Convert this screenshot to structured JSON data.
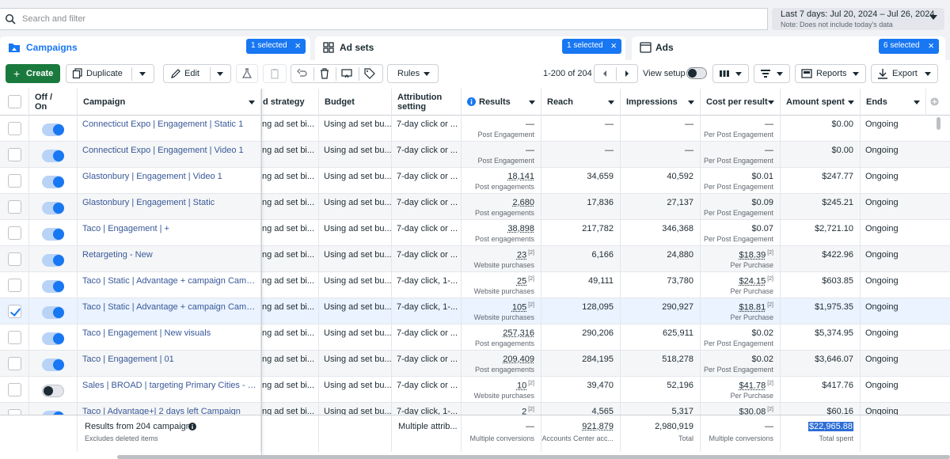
{
  "search": {
    "placeholder": "Search and filter"
  },
  "date_range": {
    "label": "Last 7 days: Jul 20, 2024 – Jul 26, 2024",
    "note": "Note: Does not include today's data"
  },
  "tabs": [
    {
      "label": "Campaigns",
      "pill": "1 selected"
    },
    {
      "label": "Ad sets",
      "pill": "1 selected"
    },
    {
      "label": "Ads",
      "pill": "6 selected"
    }
  ],
  "toolbar": {
    "create": "Create",
    "duplicate": "Duplicate",
    "edit": "Edit",
    "rules": "Rules",
    "pager": "1-200 of 204",
    "view_setup": "View setup",
    "reports": "Reports",
    "export": "Export"
  },
  "columns": {
    "onoff": "Off / On",
    "campaign": "Campaign",
    "bid_strategy": "d strategy",
    "budget": "Budget",
    "attribution": "Attribution setting",
    "results": "Results",
    "reach": "Reach",
    "impressions": "Impressions",
    "cpr": "Cost per result",
    "spent": "Amount spent",
    "ends": "Ends"
  },
  "rows": [
    {
      "name": "Connecticut Expo | Engagement | Static 1",
      "bid": "ng ad set bi...",
      "budget": "Using ad set bu...",
      "attr": "7-day click or ...",
      "results": "—",
      "results_sub": "Post Engagement",
      "reach": "—",
      "impr": "—",
      "cpr": "—",
      "cpr_sub": "Per Post Engagement",
      "spent": "$0.00",
      "ends": "Ongoing"
    },
    {
      "name": "Connecticut Expo | Engagement | Video 1",
      "bid": "ng ad set bi...",
      "budget": "Using ad set bu...",
      "attr": "7-day click or ...",
      "results": "—",
      "results_sub": "Post Engagement",
      "reach": "—",
      "impr": "—",
      "cpr": "—",
      "cpr_sub": "Per Post Engagement",
      "spent": "$0.00",
      "ends": "Ongoing"
    },
    {
      "name": "Glastonbury | Engagement | Video 1",
      "bid": "ng ad set bi...",
      "budget": "Using ad set bu...",
      "attr": "7-day click or ...",
      "results": "18,141",
      "results_sub": "Post engagements",
      "reach": "34,659",
      "impr": "40,592",
      "cpr": "$0.01",
      "cpr_sub": "Per Post Engagement",
      "spent": "$247.77",
      "ends": "Ongoing"
    },
    {
      "name": "Glastonbury | Engagement | Static",
      "bid": "ng ad set bi...",
      "budget": "Using ad set bu...",
      "attr": "7-day click or ...",
      "results": "2,680",
      "results_sub": "Post engagements",
      "reach": "17,836",
      "impr": "27,137",
      "cpr": "$0.09",
      "cpr_sub": "Per Post Engagement",
      "spent": "$245.21",
      "ends": "Ongoing"
    },
    {
      "name": "Taco | Engagement | +",
      "bid": "ng ad set bi...",
      "budget": "Using ad set bu...",
      "attr": "7-day click or ...",
      "results": "38,898",
      "results_sub": "Post engagements",
      "reach": "217,782",
      "impr": "346,368",
      "cpr": "$0.07",
      "cpr_sub": "Per Post Engagement",
      "spent": "$2,721.10",
      "ends": "Ongoing"
    },
    {
      "name": "Retargeting - New",
      "bid": "ng ad set bi...",
      "budget": "Using ad set bu...",
      "attr": "7-day click or ...",
      "results": "23",
      "results_sup": "[2]",
      "results_sub": "Website purchases",
      "reach": "6,166",
      "impr": "24,880",
      "cpr": "$18.39",
      "cpr_sup": "[2]",
      "cpr_sub": "Per Purchase",
      "spent": "$422.96",
      "ends": "Ongoing"
    },
    {
      "name": "Taco | Static | Advantage + campaign Campaign - Copy",
      "bid": "ng ad set bi...",
      "budget": "Using ad set bu...",
      "attr": "7-day click, 1-...",
      "results": "25",
      "results_sup": "[2]",
      "results_sub": "Website purchases",
      "reach": "49,111",
      "impr": "73,780",
      "cpr": "$24.15",
      "cpr_sup": "[2]",
      "cpr_sub": "Per Purchase",
      "spent": "$603.85",
      "ends": "Ongoing"
    },
    {
      "name": "Taco | Static | Advantage + campaign Campaign",
      "bid": "ng ad set bi...",
      "budget": "Using ad set bu...",
      "attr": "7-day click, 1-...",
      "results": "105",
      "results_sup": "[2]",
      "results_sub": "Website purchases",
      "reach": "128,095",
      "impr": "290,927",
      "cpr": "$18.81",
      "cpr_sup": "[2]",
      "cpr_sub": "Per Purchase",
      "spent": "$1,975.35",
      "ends": "Ongoing"
    },
    {
      "name": "Taco | Engagement | New visuals",
      "bid": "ng ad set bi...",
      "budget": "Using ad set bu...",
      "attr": "7-day click or ...",
      "results": "257,316",
      "results_sub": "Post engagements",
      "reach": "290,206",
      "impr": "625,911",
      "cpr": "$0.02",
      "cpr_sub": "Per Post Engagement",
      "spent": "$5,374.95",
      "ends": "Ongoing"
    },
    {
      "name": "Taco | Engagement | 01",
      "bid": "ng ad set bi...",
      "budget": "Using ad set bu...",
      "attr": "7-day click or ...",
      "results": "209,409",
      "results_sub": "Post engagements",
      "reach": "284,195",
      "impr": "518,278",
      "cpr": "$0.02",
      "cpr_sub": "Per Post Engagement",
      "spent": "$3,646.07",
      "ends": "Ongoing"
    },
    {
      "name": "Sales | BROAD | targeting Primary Cities - Copy",
      "bid": "ng ad set bi...",
      "budget": "Using ad set bu...",
      "attr": "7-day click or ...",
      "results": "10",
      "results_sup": "[2]",
      "results_sub": "Website purchases",
      "reach": "39,470",
      "impr": "52,196",
      "cpr": "$41.78",
      "cpr_sup": "[2]",
      "cpr_sub": "Per Purchase",
      "spent": "$417.76",
      "ends": "Ongoing"
    },
    {
      "name": "Taco | Advantage+| 2 days left Campaign",
      "bid": "ng ad set bi...",
      "budget": "Using ad set bu...",
      "attr": "7-day click, 1-...",
      "results": "2",
      "results_sup": "[2]",
      "results_sub": "",
      "reach": "4,565",
      "impr": "5,317",
      "cpr": "$30.08",
      "cpr_sup": "[2]",
      "cpr_sub": "",
      "spent": "$60.16",
      "ends": "Ongoing"
    }
  ],
  "footer": {
    "title": "Results from 204 campaigns",
    "subtitle": "Excludes deleted items",
    "attribution": "Multiple attrib...",
    "results": "—",
    "results_sub": "Multiple conversions",
    "reach": "921,879",
    "reach_sub": "Accounts Center acc...",
    "impr": "2,980,919",
    "impr_sub": "Total",
    "cpr": "—",
    "cpr_sub": "Multiple conversions",
    "spent": "$22,965.88",
    "spent_sub": "Total spent"
  },
  "colors": {
    "accent": "#1877f2",
    "create": "#1a7a3e",
    "link": "#385898"
  }
}
